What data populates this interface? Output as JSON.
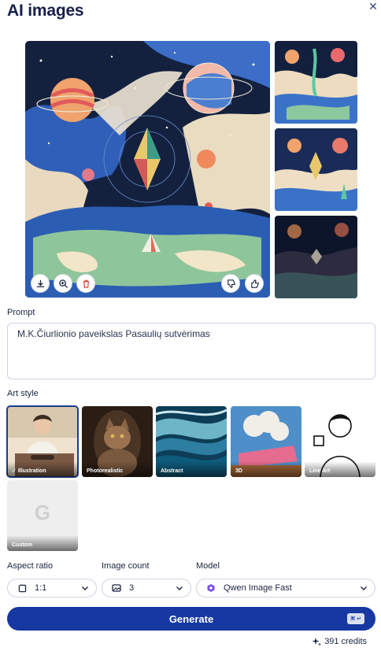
{
  "header": {
    "title": "AI images",
    "close_icon": "close-icon"
  },
  "image_actions": {
    "download_icon": "download-icon",
    "zoom_icon": "zoom-in-icon",
    "delete_icon": "trash-icon",
    "dislike_icon": "thumbs-down-icon",
    "like_icon": "thumbs-up-icon"
  },
  "prompt": {
    "label": "Prompt",
    "value": "M.K.Čiurlionio paveikslas Pasaulių sutvėrimas"
  },
  "art_style": {
    "label": "Art style",
    "options": [
      {
        "label": "Illustration",
        "selected": true
      },
      {
        "label": "Photorealistic",
        "selected": false
      },
      {
        "label": "Abstract",
        "selected": false
      },
      {
        "label": "3D",
        "selected": false
      },
      {
        "label": "Line Art",
        "selected": false
      },
      {
        "label": "Custom",
        "selected": false
      }
    ],
    "custom_glyph": "G"
  },
  "aspect_ratio": {
    "label": "Aspect ratio",
    "value": "1:1"
  },
  "image_count": {
    "label": "Image count",
    "value": "3"
  },
  "model": {
    "label": "Model",
    "value": "Qwen Image Fast"
  },
  "generate": {
    "label": "Generate",
    "shortcut": "⌘ ↵"
  },
  "credits": {
    "text": "391 credits"
  },
  "colors": {
    "primary": "#1638a0",
    "text": "#16204a",
    "delete": "#e0443c"
  }
}
